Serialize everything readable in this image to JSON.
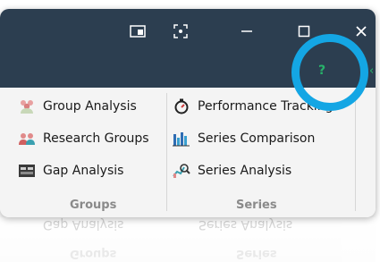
{
  "window": {
    "controls": [
      "snap-layout-icon",
      "screenshot-icon",
      "minimize-icon",
      "maximize-icon",
      "close-icon"
    ],
    "help_label": "?",
    "edge_arrow": "‹",
    "highlight_color": "#14a6e4"
  },
  "ribbon": {
    "groups": [
      {
        "label": "Groups",
        "items": [
          {
            "label": "Group Analysis",
            "icon": "group-analysis-icon"
          },
          {
            "label": "Research Groups",
            "icon": "research-groups-icon"
          },
          {
            "label": "Gap Analysis",
            "icon": "gap-analysis-icon"
          }
        ]
      },
      {
        "label": "Series",
        "items": [
          {
            "label": "Performance Tracking",
            "icon": "stopwatch-icon"
          },
          {
            "label": "Series Comparison",
            "icon": "bar-chart-icon"
          },
          {
            "label": "Series Analysis",
            "icon": "series-analysis-icon"
          }
        ]
      }
    ]
  },
  "colors": {
    "titlebar": "#2c3e50",
    "help": "#27b36a"
  }
}
